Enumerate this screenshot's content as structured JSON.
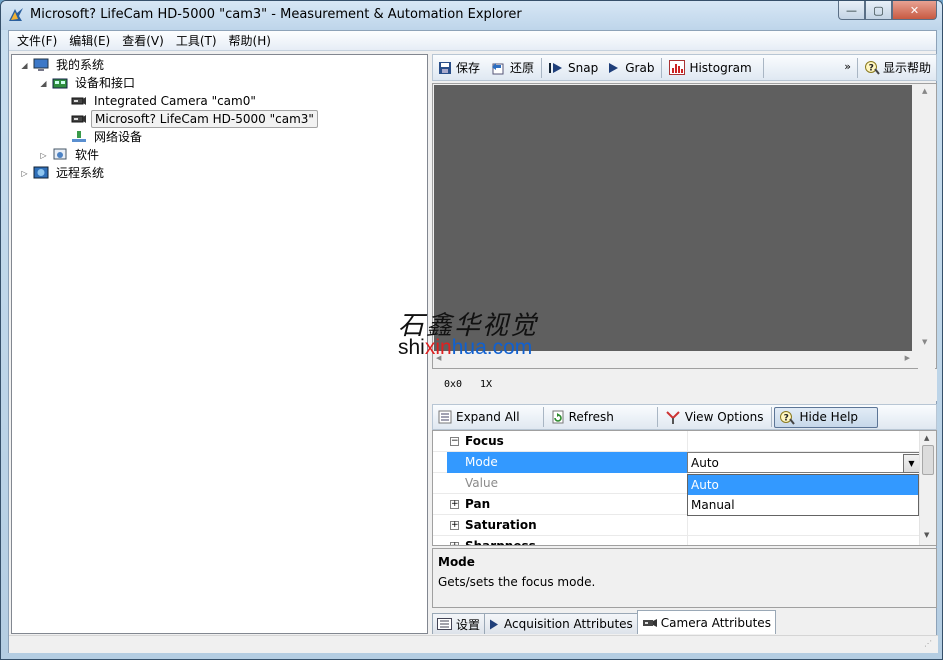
{
  "window": {
    "title": "Microsoft? LifeCam HD-5000  \"cam3\" - Measurement & Automation Explorer",
    "controls": {
      "minimize": "—",
      "maximize": "▢",
      "close": "✕"
    }
  },
  "menubar": {
    "items": [
      "文件(F)",
      "编辑(E)",
      "查看(V)",
      "工具(T)",
      "帮助(H)"
    ]
  },
  "tree": {
    "root": "我的系统",
    "devices": "设备和接口",
    "cam0": "Integrated Camera  \"cam0\"",
    "cam3": "Microsoft? LifeCam HD-5000  \"cam3\"",
    "network": "网络设备",
    "software": "软件",
    "remote": "远程系统"
  },
  "toolbar_top": {
    "save": "保存",
    "revert": "还原",
    "snap": "Snap",
    "grab": "Grab",
    "histogram": "Histogram",
    "overflow": "»",
    "show_help": "显示帮助"
  },
  "viewer": {
    "pixel_value": "0x0",
    "zoom": "1X"
  },
  "toolbar_props": {
    "expand_all": "Expand All",
    "refresh": "Refresh",
    "view_options": "View Options",
    "hide_help": "Hide Help"
  },
  "properties": {
    "focus": "Focus",
    "mode": "Mode",
    "mode_value": "Auto",
    "value": "Value",
    "pan": "Pan",
    "saturation": "Saturation",
    "sharpness": "Sharpness",
    "options": [
      "Auto",
      "Manual"
    ]
  },
  "help": {
    "title": "Mode",
    "text": "Gets/sets the focus mode."
  },
  "tabs": {
    "settings": "设置",
    "acquisition": "Acquisition Attributes",
    "camera": "Camera Attributes"
  },
  "watermark": {
    "cn": "石鑫华视觉",
    "url_a": "shi",
    "url_b": "xin",
    "url_c": "hua.com"
  },
  "colors": {
    "selection": "#3399ff",
    "viewer_bg": "#5f5f5f"
  }
}
